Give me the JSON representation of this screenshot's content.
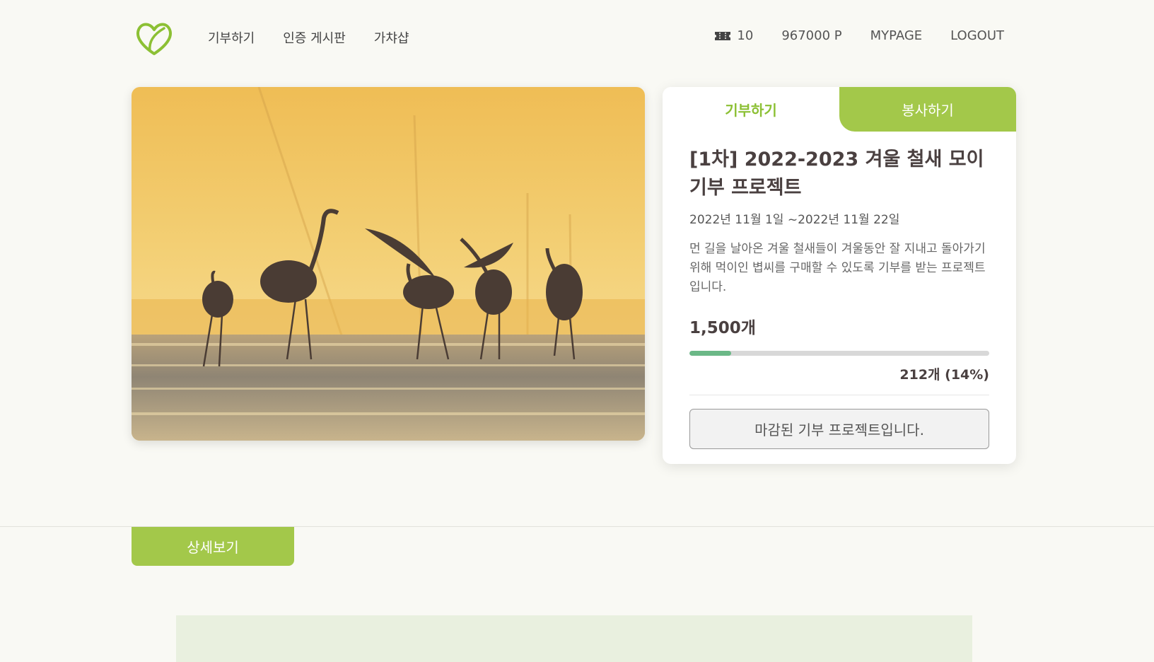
{
  "header": {
    "nav": {
      "donate": "기부하기",
      "board": "인증 게시판",
      "gacha": "가챠샵"
    },
    "ticket_count": "10",
    "points": "967000 P",
    "mypage": "MYPAGE",
    "logout": "LOGOUT"
  },
  "card": {
    "tabs": {
      "donate": "기부하기",
      "volunteer": "봉사하기"
    },
    "title": "[1차] 2022-2023 겨울 철새 모이 기부 프로젝트",
    "period": "2022년 11월 1일 ~2022년 11월 22일",
    "description": "먼 길을 날아온 겨울 철새들이 겨울동안 잘 지내고 돌아가기 위해 먹이인 볍씨를 구매할 수 있도록 기부를 받는 프로젝트입니다.",
    "goal": "1,500개",
    "progress_percent": 14,
    "progress_label": "212개 (14%)",
    "closed_message": "마감된 기부 프로젝트입니다."
  },
  "detail_tab": "상세보기",
  "colors": {
    "accent_green": "#a3c84a",
    "progress_green": "#6bb887",
    "background": "#f9f9f4"
  },
  "icons": {
    "logo": "heart-leaf-logo",
    "ticket": "ticket-icon"
  }
}
